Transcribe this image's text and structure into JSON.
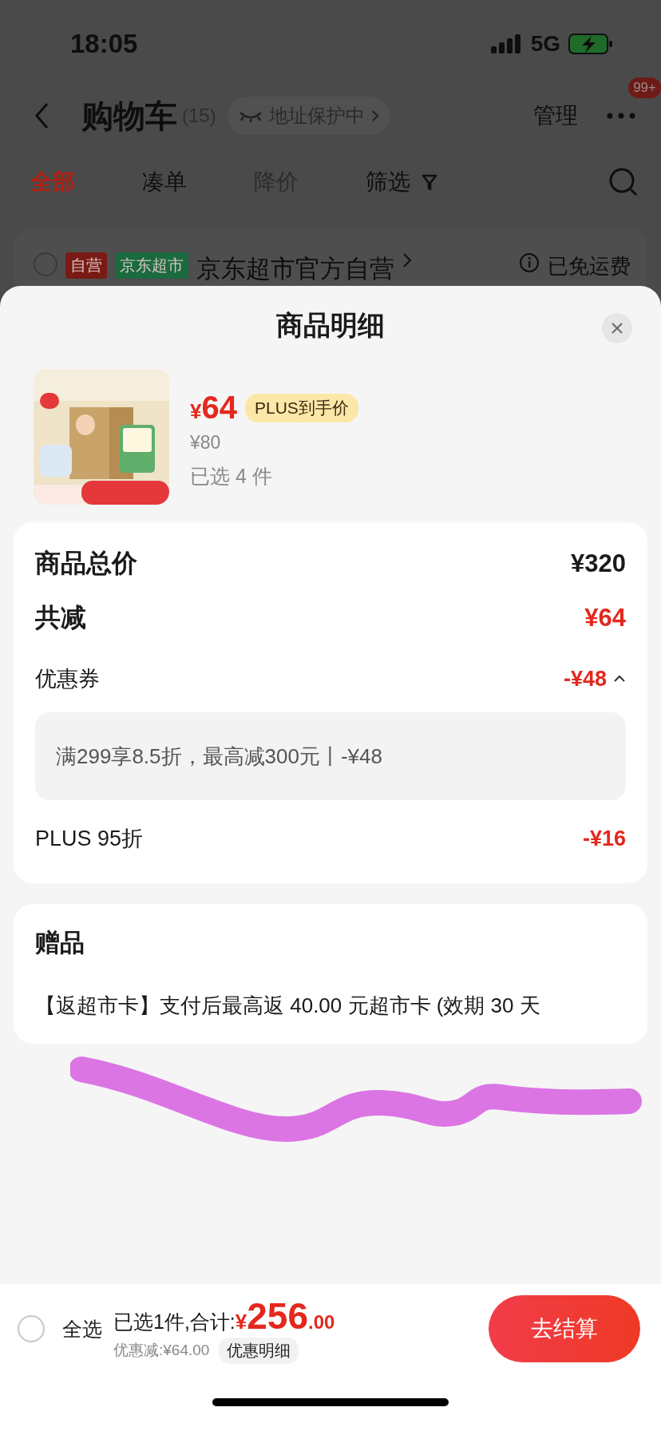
{
  "status_bar": {
    "time": "18:05",
    "network": "5G"
  },
  "nav": {
    "title": "购物车",
    "count": "(15)",
    "address_badge": "地址保护中",
    "manage": "管理",
    "more_badge": "99+"
  },
  "tabs": [
    {
      "label": "全部",
      "selected": true,
      "disabled": false
    },
    {
      "label": "凑单",
      "selected": false,
      "disabled": false
    },
    {
      "label": "降价",
      "selected": false,
      "disabled": true
    },
    {
      "label": "筛选",
      "selected": false,
      "disabled": false
    }
  ],
  "store": {
    "checked": false,
    "tags": [
      {
        "label": "自营",
        "color": "#7a1a14"
      },
      {
        "label": "京东超市",
        "color": "#1a6b3f"
      }
    ],
    "name": "京东超市官方自营",
    "shipping": "已免运费"
  },
  "sheet": {
    "title": "商品明细",
    "product": {
      "kind": "picture",
      "price_symbol": "¥",
      "price": "64",
      "price_tag": "PLUS到手价",
      "original_price": "¥80",
      "selected_count": "已选 4 件"
    },
    "summary": [
      {
        "kind": "total",
        "label": "商品总价",
        "value": "¥320"
      },
      {
        "kind": "reduce",
        "label": "共减",
        "value": "¥64"
      },
      {
        "kind": "coupon",
        "label": "优惠券",
        "value": "-¥48",
        "expanded": true,
        "detail": "满299享8.5折，最高减300元丨-¥48"
      },
      {
        "kind": "discount",
        "label": "PLUS 95折",
        "value": "-¥16"
      }
    ],
    "gift": {
      "title": "赠品",
      "text": "【返超市卡】支付后最高返 40.00 元超市卡 (效期 30 天"
    }
  },
  "bottom_bar": {
    "select_all_checked": false,
    "select_all": "全选",
    "selected_label": "已选1件,合计:",
    "total_symbol": "¥",
    "total_int": "256",
    "total_dec": ".00",
    "discount": "优惠减:¥64.00",
    "discount_detail": "优惠明细",
    "checkout": "去结算"
  }
}
